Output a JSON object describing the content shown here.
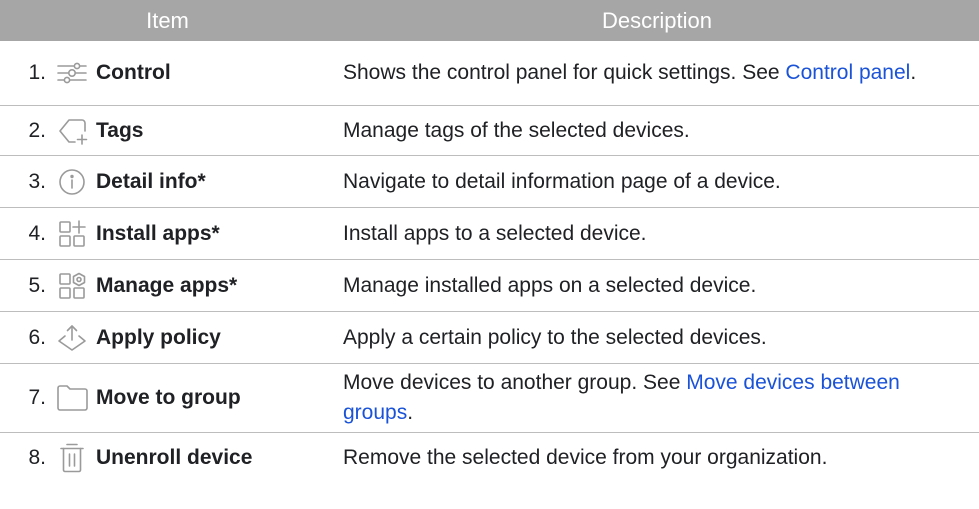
{
  "header": {
    "item": "Item",
    "description": "Description"
  },
  "rows": [
    {
      "num": "1.",
      "icon": "sliders-icon",
      "name": "Control",
      "desc": "Shows the control panel for quick settings. See ",
      "link": "Control panel",
      "after": "."
    },
    {
      "num": "2.",
      "icon": "tag-add-icon",
      "name": "Tags",
      "desc": "Manage tags of the selected devices.",
      "link": "",
      "after": ""
    },
    {
      "num": "3.",
      "icon": "info-icon",
      "name": "Detail info*",
      "desc": "Navigate to detail information page of a device.",
      "link": "",
      "after": ""
    },
    {
      "num": "4.",
      "icon": "install-apps-icon",
      "name": "Install apps*",
      "desc": "Install apps to a selected device.",
      "link": "",
      "after": ""
    },
    {
      "num": "5.",
      "icon": "manage-apps-icon",
      "name": "Manage apps*",
      "desc": "Manage installed apps on a selected device.",
      "link": "",
      "after": ""
    },
    {
      "num": "6.",
      "icon": "apply-policy-icon",
      "name": "Apply policy",
      "desc": "Apply a certain policy to the selected devices.",
      "link": "",
      "after": ""
    },
    {
      "num": "7.",
      "icon": "folder-icon",
      "name": "Move to group",
      "desc": "Move devices to another group. See ",
      "link": "Move devices between groups",
      "after": "."
    },
    {
      "num": "8.",
      "icon": "trash-icon",
      "name": "Unenroll device",
      "desc": "Remove the selected device from your organization.",
      "link": "",
      "after": ""
    }
  ]
}
